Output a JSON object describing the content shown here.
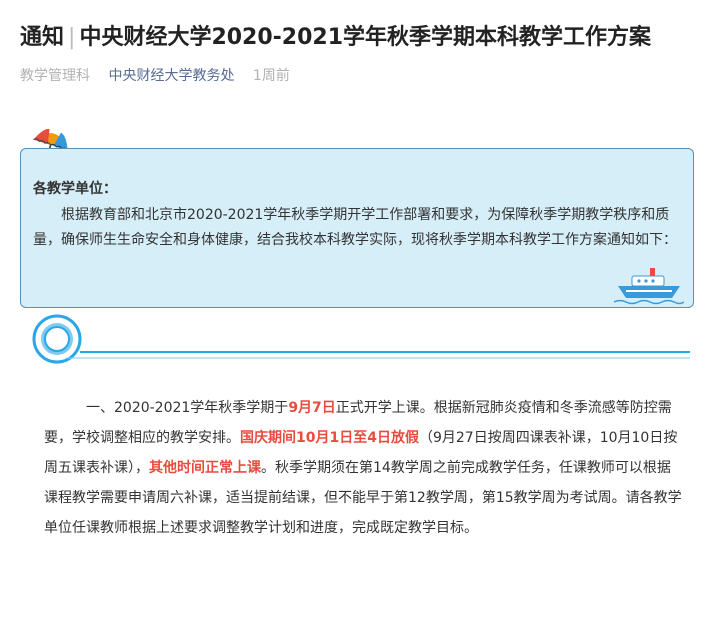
{
  "article": {
    "category": "通知",
    "separator": "|",
    "headline": "中央财经大学2020-2021学年秋季学期本科教学工作方案",
    "meta": {
      "column": "教学管理科",
      "account": "中央财经大学教务处",
      "time": "1周前"
    }
  },
  "notice": {
    "salutation": "各教学单位：",
    "intro": "根据教育部和北京市2020-2021学年秋季学期开学工作部署和要求，为保障秋季学期教学秩序和质量，确保师生生命安全和身体健康，结合我校本科教学实际，现将秋季学期本科教学工作方案通知如下："
  },
  "section1": {
    "seg1": "一、2020-2021学年秋季学期于",
    "hl1": "9月7日",
    "seg2": "正式开学上课。根据新冠肺炎疫情和冬季流感等防控需要，学校调整相应的教学安排。",
    "hl2": "国庆期间10月1日至4日放假",
    "seg3": "（9月27日按周四课表补课，10月10日按周五课表补课），",
    "hl3": "其他时间正常上课",
    "seg4": "。秋季学期须在第14教学周之前完成教学任务，任课教师可以根据课程教学需要申请周六补课，适当提前结课，但不能早于第12教学周，第15教学周为考试周。请各教学单位任课教师根据上述要求调整教学计划和进度，完成既定教学目标。"
  },
  "colors": {
    "highlight": "#e84c3d",
    "link": "#576b95",
    "notice_bg": "#d6eef8",
    "notice_border": "#5a8fb0",
    "accent_blue": "#2aa7e8"
  },
  "icons": {
    "umbrella": "umbrella-icon",
    "ship": "ship-icon",
    "divider": "circle-divider-icon"
  }
}
